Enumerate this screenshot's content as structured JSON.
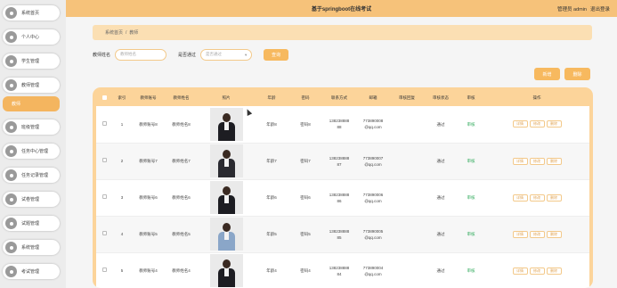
{
  "header": {
    "title": "基于springboot在线考试",
    "user_label": "管理员 admin",
    "logout_label": "退出登录"
  },
  "sidebar": {
    "items": [
      {
        "label": "系统首页"
      },
      {
        "label": "个人中心"
      },
      {
        "label": "学生管理"
      },
      {
        "label": "教师管理"
      },
      {
        "label": "班级管理"
      },
      {
        "label": "任务中心管理"
      },
      {
        "label": "任务记录管理"
      },
      {
        "label": "试卷管理"
      },
      {
        "label": "试题管理"
      },
      {
        "label": "系统管理"
      },
      {
        "label": "考试管理"
      }
    ],
    "active_sub": "教师"
  },
  "breadcrumb": {
    "home": "系统首页",
    "sep": "/",
    "current": "教师"
  },
  "search": {
    "name_label": "教师姓名",
    "name_placeholder": "教师姓名",
    "audit_label": "是否通过",
    "audit_placeholder": "是否通过",
    "search_button": "查询"
  },
  "toolbar": {
    "add_label": "新增",
    "delete_label": "删除"
  },
  "colors": {
    "accent": "#f7b95f",
    "header_bg": "#f6c27a",
    "status_ok": "#2eaa5a"
  },
  "table": {
    "headers": [
      "",
      "索引",
      "教师账号",
      "教师姓名",
      "照片",
      "年龄",
      "密码",
      "联系方式",
      "邮箱",
      "审核回复",
      "审核状态",
      "审核",
      "操作"
    ],
    "rows": [
      {
        "index": "1",
        "account": "教师账号8",
        "name": "教师姓名8",
        "age": "年龄8",
        "password": "密码8",
        "phone1": "138238888",
        "phone2": "88",
        "email1": "773890008",
        "email2": "@qq.com",
        "reply": "",
        "status": "通过",
        "audit": "审核"
      },
      {
        "index": "2",
        "account": "教师账号7",
        "name": "教师姓名7",
        "age": "年龄7",
        "password": "密码7",
        "phone1": "138238888",
        "phone2": "87",
        "email1": "773890007",
        "email2": "@qq.com",
        "reply": "",
        "status": "通过",
        "audit": "审核"
      },
      {
        "index": "3",
        "account": "教师账号6",
        "name": "教师姓名6",
        "age": "年龄6",
        "password": "密码6",
        "phone1": "138238888",
        "phone2": "86",
        "email1": "773890006",
        "email2": "@qq.com",
        "reply": "",
        "status": "通过",
        "audit": "审核"
      },
      {
        "index": "4",
        "account": "教师账号5",
        "name": "教师姓名5",
        "age": "年龄5",
        "password": "密码5",
        "phone1": "138238888",
        "phone2": "85",
        "email1": "773890005",
        "email2": "@qq.com",
        "reply": "",
        "status": "通过",
        "audit": "审核"
      },
      {
        "index": "5",
        "account": "教师账号4",
        "name": "教师姓名4",
        "age": "年龄4",
        "password": "密码4",
        "phone1": "138238888",
        "phone2": "84",
        "email1": "773890004",
        "email2": "@qq.com",
        "reply": "",
        "status": "通过",
        "audit": "审核"
      }
    ],
    "op_labels": [
      "详情",
      "修改",
      "删除"
    ]
  }
}
